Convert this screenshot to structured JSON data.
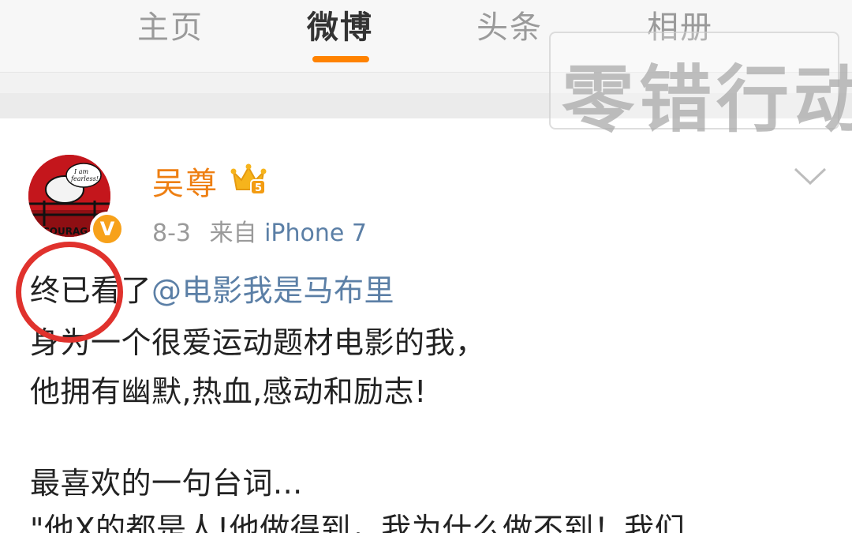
{
  "tabs": [
    {
      "label": "主页",
      "active": false
    },
    {
      "label": "微博",
      "active": true
    },
    {
      "label": "头条",
      "active": false
    },
    {
      "label": "相册",
      "active": false
    }
  ],
  "watermark": {
    "text": "零错行动"
  },
  "colors": {
    "accent": "#ff8200",
    "username": "#ee7f12",
    "link": "#5b7fa6",
    "annotation": "#e0322d"
  },
  "post": {
    "avatar": {
      "caption_line1": "I am",
      "caption_line2": "fearless!",
      "bottom_text": "COURAG",
      "verified_badge": "V"
    },
    "username": "吴尊",
    "member_icon": "crown-icon",
    "date": "8-3",
    "source_prefix": "来自",
    "device": "iPhone 7",
    "line1_text": "终已看了",
    "line1_mention": "@电影我是马布里",
    "line2": "身为一个很爱运动题材电影的我，",
    "line3": "他拥有幽默,热血,感动和励志!",
    "line4": "最喜欢的一句台词...",
    "line5": "\"他X的都是人!他做得到，我为什么做不到！我们"
  }
}
